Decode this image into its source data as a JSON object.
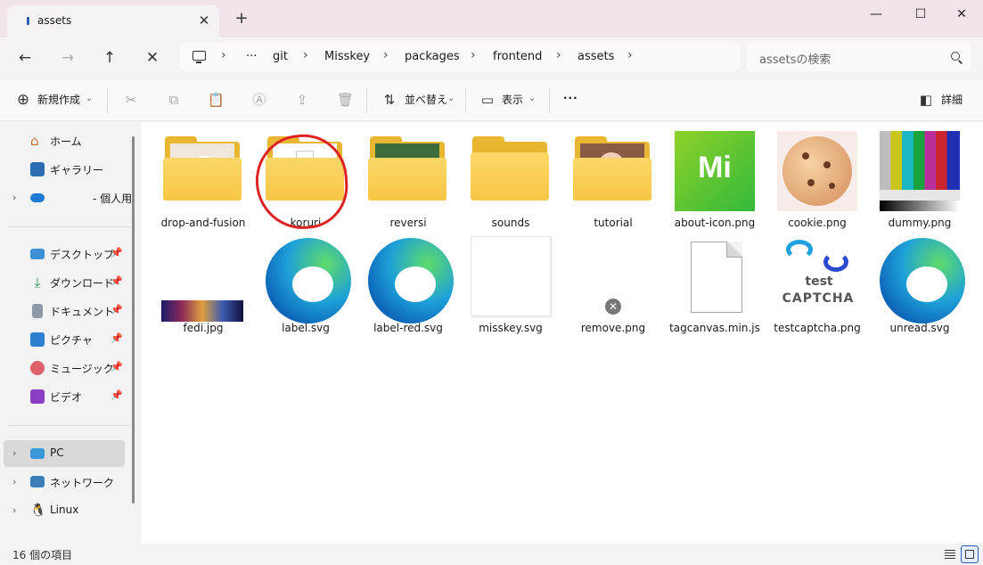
{
  "window": {
    "tab_title": "assets",
    "new_tab": "+",
    "minimize": "—",
    "maximize": "☐",
    "close": "✕"
  },
  "nav": {
    "back": "←",
    "forward": "→",
    "up": "↑",
    "stop": "✕"
  },
  "breadcrumb": [
    "git",
    "Misskey",
    "packages",
    "frontend",
    "assets"
  ],
  "breadcrumb_more": "···",
  "search": {
    "placeholder": "assetsの検索"
  },
  "commands": {
    "new": "新規作成",
    "sort": "並べ替え",
    "view": "表示",
    "more": "···",
    "details": "詳細"
  },
  "sidebar": {
    "home": "ホーム",
    "gallery": "ギャラリー",
    "onedrive": "- 個人用",
    "desktop": "デスクトップ",
    "downloads": "ダウンロード",
    "documents": "ドキュメント",
    "pictures": "ピクチャ",
    "music": "ミュージック",
    "videos": "ビデオ",
    "pc": "PC",
    "network": "ネットワーク",
    "linux": "Linux"
  },
  "files": [
    {
      "name": "drop-and-fusion",
      "type": "folder"
    },
    {
      "name": "koruri",
      "type": "folder"
    },
    {
      "name": "reversi",
      "type": "folder"
    },
    {
      "name": "sounds",
      "type": "folder"
    },
    {
      "name": "tutorial",
      "type": "folder"
    },
    {
      "name": "about-icon.png",
      "type": "image"
    },
    {
      "name": "cookie.png",
      "type": "image"
    },
    {
      "name": "dummy.png",
      "type": "image"
    },
    {
      "name": "fedi.jpg",
      "type": "image"
    },
    {
      "name": "label.svg",
      "type": "svg"
    },
    {
      "name": "label-red.svg",
      "type": "svg"
    },
    {
      "name": "misskey.svg",
      "type": "svg"
    },
    {
      "name": "remove.png",
      "type": "image"
    },
    {
      "name": "tagcanvas.min.js",
      "type": "file"
    },
    {
      "name": "testcaptcha.png",
      "type": "image"
    },
    {
      "name": "unread.svg",
      "type": "svg"
    }
  ],
  "thumb_text": {
    "about_icon": "Mi",
    "captcha_line1": "test",
    "captcha_line2": "CAPTCHA"
  },
  "status": {
    "count": "16 個の項目"
  },
  "colors": {
    "accent": "#2b5fb3",
    "annotation": "#dd2222",
    "folder": "#f7c646"
  }
}
